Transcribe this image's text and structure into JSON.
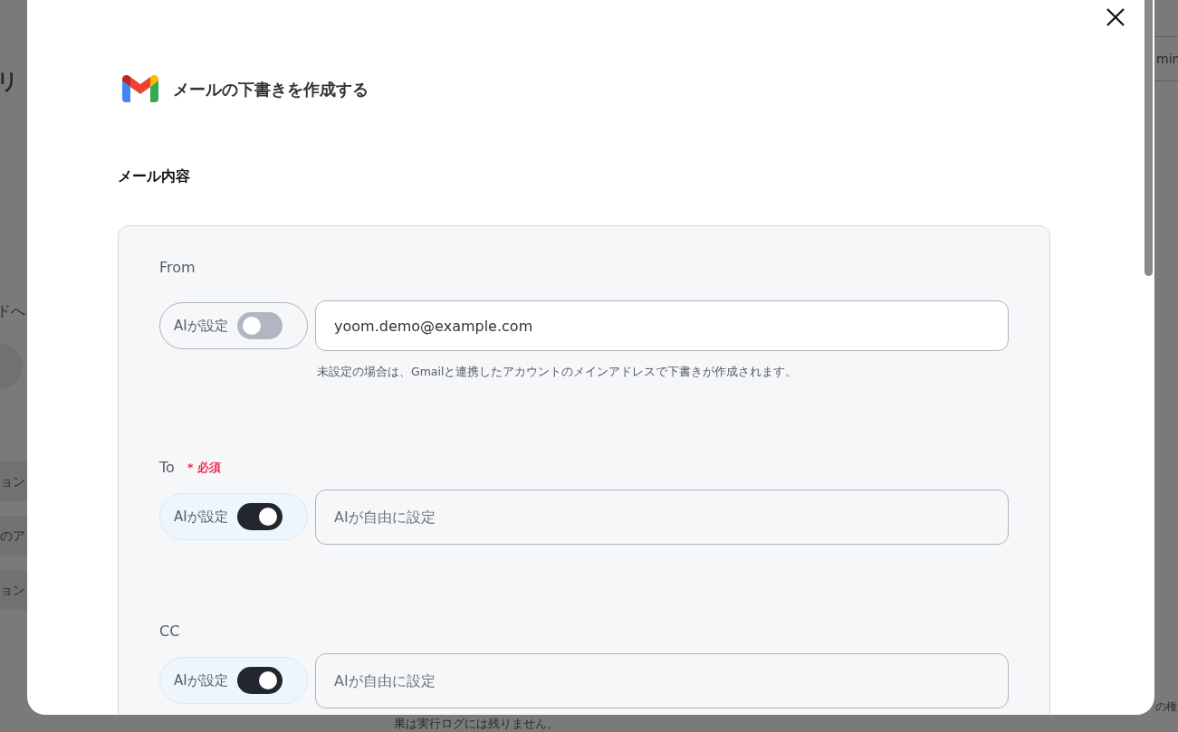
{
  "backdrop": {
    "texts": [
      {
        "kind": "heading",
        "text": "リ"
      },
      {
        "kind": "subheading",
        "text": "ドへ"
      },
      {
        "kind": "pill",
        "text": "ョン"
      },
      {
        "kind": "pill",
        "text": "のア"
      },
      {
        "kind": "pill",
        "text": "ョン"
      },
      {
        "kind": "tab",
        "text": "min"
      },
      {
        "kind": "dropdown",
        "text": "の権"
      },
      {
        "kind": "note",
        "text": "果は実行ログには残りません。"
      }
    ]
  },
  "dialog": {
    "title": "メールの下書きを作成する",
    "section_title": "メール内容",
    "fields": [
      {
        "label": "From",
        "ai_toggle": {
          "label": "AIが設定",
          "on": false
        },
        "value": "yoom.demo@example.com",
        "hint": "未設定の場合は、Gmailと連携したアカウントのメインアドレスで下書きが作成されます。"
      },
      {
        "label": "To",
        "required": {
          "mark": "*",
          "label": "必須"
        },
        "ai_toggle": {
          "label": "AIが設定",
          "on": true
        },
        "placeholder": "AIが自由に設定"
      },
      {
        "label": "CC",
        "ai_toggle": {
          "label": "AIが設定",
          "on": true
        },
        "placeholder": "AIが自由に設定"
      }
    ]
  }
}
